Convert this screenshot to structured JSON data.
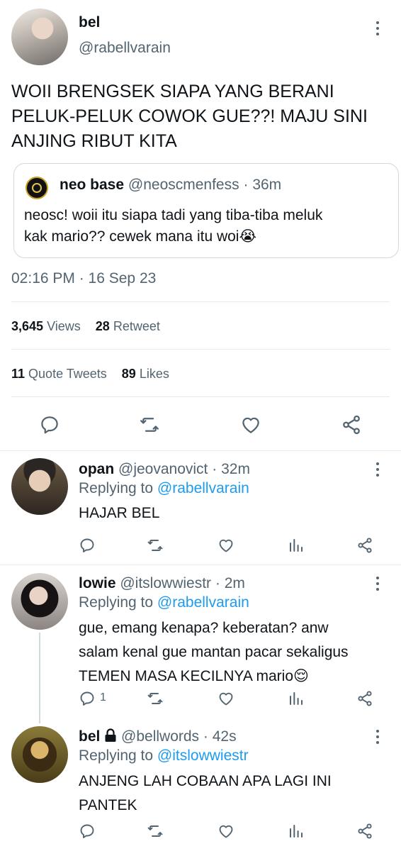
{
  "main_tweet": {
    "name": "bel",
    "handle": "@rabellvarain",
    "text_lines": [
      "WOII BRENGSEK SIAPA YANG BERANI",
      "PELUK-PELUK COWOK GUE??! MAJU SINI",
      "ANJING RIBUT KITA"
    ],
    "quote": {
      "name": "neo base",
      "handle": "@neoscmenfess",
      "separator": "·",
      "time": "36m",
      "text_lines": [
        "neosc! woii itu siapa tadi yang tiba-tiba meluk",
        "kak mario?? cewek mana itu woi😭"
      ]
    },
    "timestamp": "02:16 PM · 16 Sep 23",
    "stats": {
      "views_count": "3,645",
      "views_label": "Views",
      "retweets_count": "28",
      "retweets_label": "Retweet",
      "quotes_count": "11",
      "quotes_label": "Quote Tweets",
      "likes_count": "89",
      "likes_label": "Likes"
    }
  },
  "replies": [
    {
      "name": "opan",
      "handle": "@jeovanovict",
      "separator": "·",
      "time": "32m",
      "replying_prefix": "Replying to",
      "replying_handle": "@rabellvarain",
      "text_lines": [
        "HAJAR BEL"
      ],
      "reply_count": ""
    },
    {
      "name": "lowie",
      "handle": "@itslowwiestr",
      "separator": "·",
      "time": "2m",
      "replying_prefix": "Replying to",
      "replying_handle": "@rabellvarain",
      "text_lines": [
        "gue, emang kenapa? keberatan? anw",
        "salam kenal gue mantan pacar sekaligus",
        "TEMEN MASA KECILNYA mario😌"
      ],
      "reply_count": "1"
    },
    {
      "name": "bel",
      "handle": "@bellwords",
      "separator": "·",
      "time": "42s",
      "replying_prefix": "Replying to",
      "replying_handle": "@itslowwiestr",
      "text_lines": [
        "ANJENG LAH COBAAN APA LAGI INI",
        "PANTEK"
      ],
      "reply_count": ""
    }
  ],
  "icons": {
    "reply": "speech-bubble-icon",
    "retweet": "retweet-icon",
    "like": "heart-icon",
    "share": "share-icon",
    "analytics": "bar-chart-icon",
    "more": "more-vertical-icon",
    "lock": "lock-icon"
  },
  "colors": {
    "link": "#1d9bf0",
    "muted": "#536471",
    "text": "#0f1419",
    "divider": "#e7eaed"
  }
}
